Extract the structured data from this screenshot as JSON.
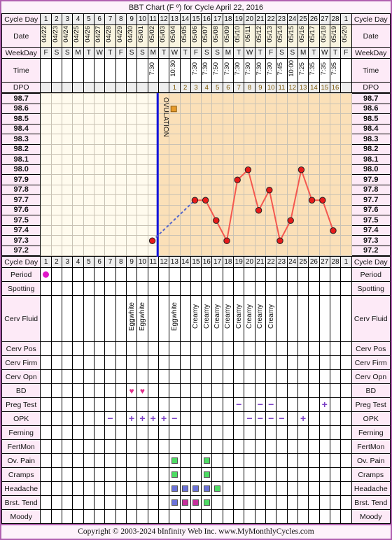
{
  "title": "BBT Chart (F º) for Cycle April 22, 2016",
  "footer": "Copyright © 2003-2024 bInfinity Web Inc.    www.MyMonthlyCycles.com",
  "row_labels": {
    "cycle_day": "Cycle Day",
    "date": "Date",
    "weekday": "WeekDay",
    "time": "Time",
    "dpo": "DPO",
    "period": "Period",
    "spotting": "Spotting",
    "cerv_fluid": "Cerv Fluid",
    "cerv_pos": "Cerv Pos",
    "cerv_firm": "Cerv Firm",
    "cerv_opn": "Cerv Opn",
    "bd": "BD",
    "preg_test": "Preg Test",
    "opk": "OPK",
    "ferning": "Ferning",
    "fertmon": "FertMon",
    "ov_pain": "Ov. Pain",
    "cramps": "Cramps",
    "headache": "Headache",
    "brst_tend": "Brst. Tend",
    "moody": "Moody"
  },
  "ovulation_label": "OVULATION",
  "colors": {
    "period_dot": "#e018c8",
    "bd_heart": "#e0308a",
    "symbol_purple": "#7b3fc4",
    "temp_line": "#f4584f",
    "temp_point": "#e81b1b",
    "pre_ov_dash": "#5566cc",
    "ovulation_line": "#1414dc",
    "luteal_bg": "#fbe0b8",
    "follicular_bg": "#fffbee",
    "sq_green": "#4ddb63",
    "sq_blue": "#6b72d8",
    "sq_magenta": "#c62f9b",
    "border_purple": "#b060b0",
    "coverline": "#e89b2a"
  },
  "chart_data": {
    "type": "line",
    "title": "BBT Chart (F º) for Cycle April 22, 2016",
    "xlabel": "Cycle Day",
    "ylabel": "Temperature (Fº)",
    "ylim": [
      97.2,
      98.7
    ],
    "y_ticks": [
      "98.7",
      "98.6",
      "98.5",
      "98.4",
      "98.3",
      "98.2",
      "98.1",
      "98.0",
      "97.9",
      "97.8",
      "97.7",
      "97.6",
      "97.5",
      "97.4",
      "97.3",
      "97.2"
    ],
    "grid": true,
    "ovulation_cycle_day": 12,
    "cycle_days": [
      1,
      2,
      3,
      4,
      5,
      6,
      7,
      8,
      9,
      10,
      11,
      12,
      13,
      14,
      15,
      16,
      17,
      18,
      19,
      20,
      21,
      22,
      23,
      24,
      25,
      26,
      27,
      28,
      1
    ],
    "dates": [
      "04/22",
      "04/23",
      "04/24",
      "04/25",
      "04/26",
      "04/27",
      "04/28",
      "04/29",
      "04/30",
      "05/01",
      "05/02",
      "05/03",
      "05/04",
      "05/05",
      "05/06",
      "05/07",
      "05/08",
      "05/09",
      "05/10",
      "05/11",
      "05/12",
      "05/13",
      "05/14",
      "05/15",
      "05/16",
      "05/17",
      "05/18",
      "05/19",
      "05/20"
    ],
    "weekdays": [
      "F",
      "S",
      "S",
      "M",
      "T",
      "W",
      "T",
      "F",
      "S",
      "S",
      "M",
      "T",
      "W",
      "T",
      "F",
      "S",
      "S",
      "M",
      "T",
      "W",
      "T",
      "F",
      "S",
      "S",
      "M",
      "T",
      "W",
      "T",
      "F"
    ],
    "times": [
      "",
      "",
      "",
      "",
      "",
      "",
      "",
      "",
      "",
      "",
      "7:30",
      "",
      "10:30",
      "",
      "7:30",
      "7:30",
      "7:50",
      "7:30",
      "7:30",
      "7:30",
      "7:30",
      "7:30",
      "7:45",
      "10:00",
      "7:25",
      "7:35",
      "7:35",
      "7:35",
      ""
    ],
    "dpo": [
      "",
      "",
      "",
      "",
      "",
      "",
      "",
      "",
      "",
      "",
      "",
      "",
      "1",
      "2",
      "3",
      "4",
      "5",
      "6",
      "7",
      "8",
      "9",
      "10",
      "11",
      "12",
      "13",
      "14",
      "15",
      "16",
      ""
    ],
    "temperatures": [
      null,
      null,
      null,
      null,
      null,
      null,
      null,
      null,
      null,
      null,
      97.3,
      null,
      null,
      null,
      97.7,
      97.7,
      97.5,
      97.3,
      97.9,
      98.0,
      97.6,
      97.8,
      97.3,
      97.5,
      98.0,
      97.7,
      97.7,
      97.4,
      null
    ],
    "series": [
      {
        "name": "BBT",
        "x": [
          11,
          15,
          16,
          17,
          18,
          19,
          20,
          21,
          22,
          23,
          24,
          25,
          26,
          27,
          28
        ],
        "y": [
          97.3,
          97.7,
          97.7,
          97.5,
          97.3,
          97.9,
          98.0,
          97.6,
          97.8,
          97.3,
          97.5,
          98.0,
          97.7,
          97.7,
          97.4
        ]
      }
    ]
  },
  "tracking": {
    "period": [
      1,
      29
    ],
    "spotting": [],
    "cerv_fluid": {
      "9": "Eggwhite",
      "10": "Eggwhite",
      "13": "Eggwhite",
      "15": "Creamy",
      "16": "Creamy",
      "17": "Creamy",
      "18": "Creamy",
      "19": "Creamy",
      "20": "Creamy",
      "21": "Creamy",
      "22": "Creamy"
    },
    "cerv_pos": {},
    "cerv_firm": {},
    "cerv_opn": {},
    "bd": [
      9,
      10
    ],
    "preg_test": {
      "19": "−",
      "21": "−",
      "22": "−",
      "27": "+"
    },
    "opk": {
      "7": "−",
      "9": "+",
      "10": "+",
      "11": "+",
      "12": "+",
      "13": "−",
      "20": "−",
      "21": "−",
      "22": "−",
      "23": "−",
      "25": "+"
    },
    "ferning": {},
    "fertmon": {},
    "ov_pain": {
      "13": "green",
      "16": "green"
    },
    "cramps": {
      "13": "green",
      "16": "green"
    },
    "headache": {
      "13": "blue",
      "14": "blue",
      "15": "blue",
      "16": "blue",
      "17": "green"
    },
    "brst_tend": {
      "13": "blue",
      "14": "magenta",
      "15": "magenta",
      "16": "green"
    },
    "moody": {}
  }
}
